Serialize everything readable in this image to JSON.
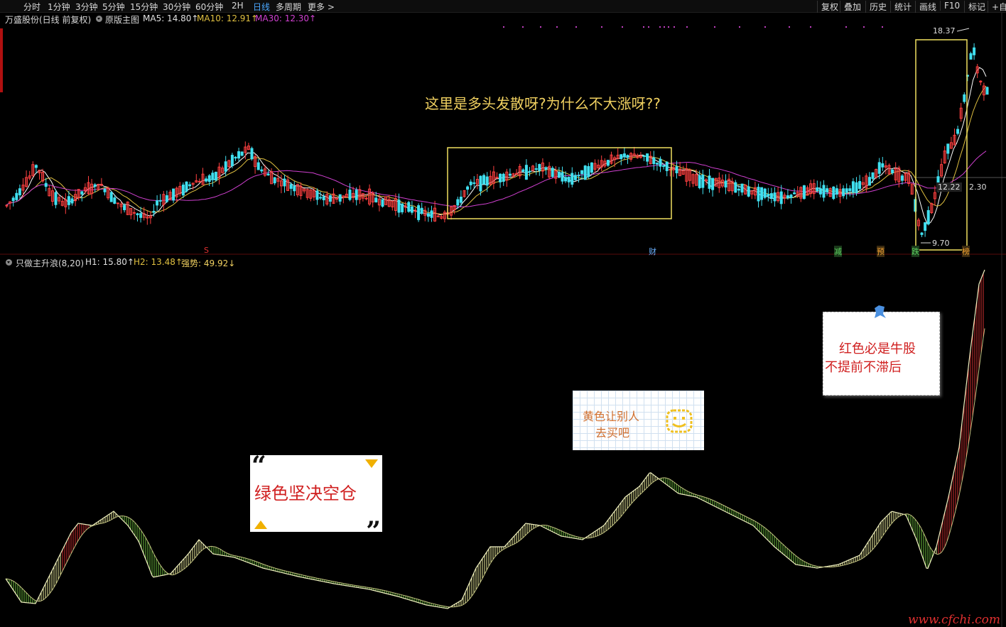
{
  "toolbar": {
    "periods": [
      "分时",
      "1分钟",
      "3分钟",
      "5分钟",
      "15分钟",
      "30分钟",
      "60分钟",
      "2H",
      "日线",
      "多周期",
      "更多 >"
    ],
    "active_period": "日线",
    "right_tools": [
      "复权",
      "叠加",
      "历史",
      "统计",
      "画线",
      "F10",
      "标记",
      "+自"
    ]
  },
  "main_chart": {
    "stock_title": "万盛股份(日线 前复权)",
    "mode_label": "原版主图",
    "ma5": "MA5: 14.80↑",
    "ma10": "MA10: 12.91↑",
    "ma30": "MA30: 12.30↑",
    "price_high_label": "18.37",
    "price_low_label": "9.70",
    "price_cursor_label": "12.22",
    "price_axis_label": "2.30",
    "annotation": "这里是多头发散呀?为什么不大涨呀??",
    "event_markers": [
      "S",
      "财",
      "减",
      "预",
      "跌",
      "榜"
    ]
  },
  "indicator": {
    "name": "只做主升浪(8,20)",
    "h1": "H1: 15.80↑",
    "h2": "H2: 13.48↑",
    "strength": "强势: 49.92↓"
  },
  "notes": {
    "red_note_line1": "红色必是牛股",
    "red_note_line2": "不提前不滞后",
    "yellow_note_line1": "黄色让别人",
    "yellow_note_line2": "去买吧",
    "green_note": "绿色坚决空仓"
  },
  "watermark": "www.cfchi.com",
  "colors": {
    "up": "#ff4040",
    "down": "#40e0f0",
    "ma5": "#ffffff",
    "ma10": "#e0c040",
    "ma30": "#d040d0",
    "highlight_box": "#f0e060",
    "wave_red": "#d03030",
    "wave_yellow": "#f0f0a0",
    "wave_green": "#70c040"
  },
  "chart_data": [
    {
      "type": "candlestick",
      "title": "万盛股份(日线 前复权)",
      "series": [
        {
          "name": "MA5",
          "last": 14.8
        },
        {
          "name": "MA10",
          "last": 12.91
        },
        {
          "name": "MA30",
          "last": 12.3
        }
      ],
      "high": 18.37,
      "low": 9.7
    },
    {
      "type": "area",
      "title": "只做主升浪(8,20)",
      "series": [
        {
          "name": "H1",
          "last": 15.8
        },
        {
          "name": "H2",
          "last": 13.48
        },
        {
          "name": "强势",
          "last": 49.92
        }
      ]
    }
  ]
}
